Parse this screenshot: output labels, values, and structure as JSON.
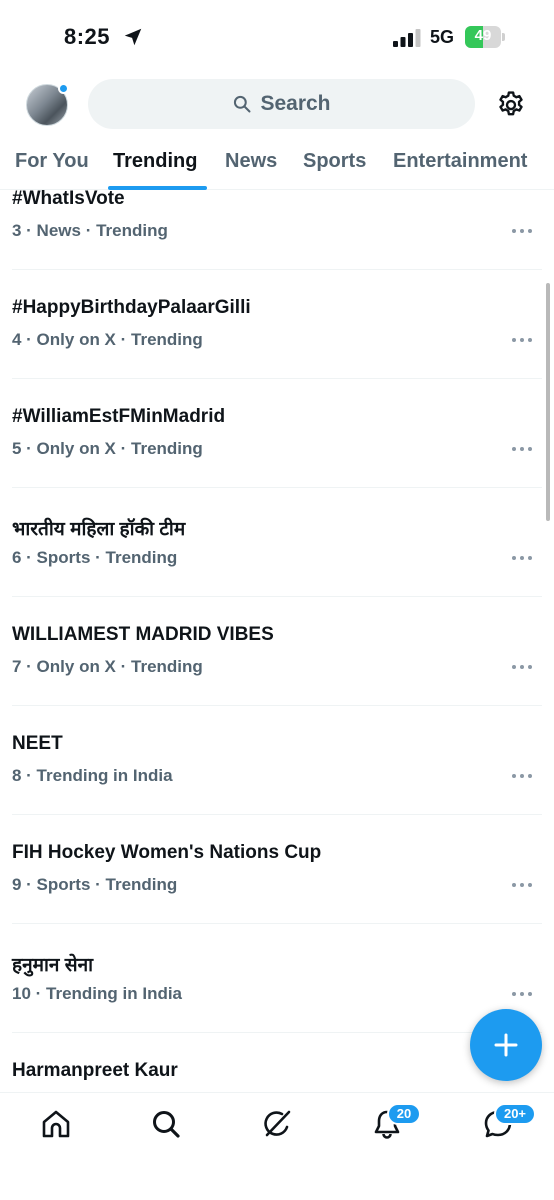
{
  "status_bar": {
    "time": "8:25",
    "network": "5G",
    "battery_percent": "49",
    "battery_level": 0.49,
    "icons": [
      "location-arrow-icon",
      "cellular-signal-icon",
      "battery-charging-icon"
    ]
  },
  "header": {
    "search_label": "Search",
    "icons": [
      "avatar",
      "search-icon",
      "gear-icon"
    ]
  },
  "tabs": [
    {
      "label": "For You",
      "active": false
    },
    {
      "label": "Trending",
      "active": true
    },
    {
      "label": "News",
      "active": false
    },
    {
      "label": "Sports",
      "active": false
    },
    {
      "label": "Entertainment",
      "active": false
    }
  ],
  "trends": [
    {
      "title": "#WhatIsVote",
      "meta": "3 · News · Trending"
    },
    {
      "title": "#HappyBirthdayPalaarGilli",
      "meta": "4 · Only on X · Trending"
    },
    {
      "title": "#WilliamEstFMinMadrid",
      "meta": "5 · Only on X · Trending"
    },
    {
      "title": "भारतीय महिला हॉकी टीम",
      "meta": "6 · Sports · Trending"
    },
    {
      "title": "WILLIAMEST MADRID VIBES",
      "meta": "7 · Only on X · Trending"
    },
    {
      "title": "NEET",
      "meta": "8 · Trending in India"
    },
    {
      "title": "FIH Hockey Women's Nations Cup",
      "meta": "9 · Sports · Trending"
    },
    {
      "title": "हनुमान सेना",
      "meta": "10 · Trending in India"
    },
    {
      "title": "Harmanpreet Kaur",
      "meta": ""
    }
  ],
  "fab": {
    "icon": "plus-icon"
  },
  "bottom_nav": {
    "items": [
      "home-icon",
      "explore-icon",
      "grok-icon",
      "notifications-icon",
      "messages-icon"
    ],
    "notifications_badge": "20",
    "messages_badge": "20+"
  },
  "colors": {
    "accent": "#1d9bf0",
    "text_primary": "#0f1419",
    "text_secondary": "#536471",
    "search_bg": "#eff3f4",
    "battery_green": "#34c759"
  }
}
